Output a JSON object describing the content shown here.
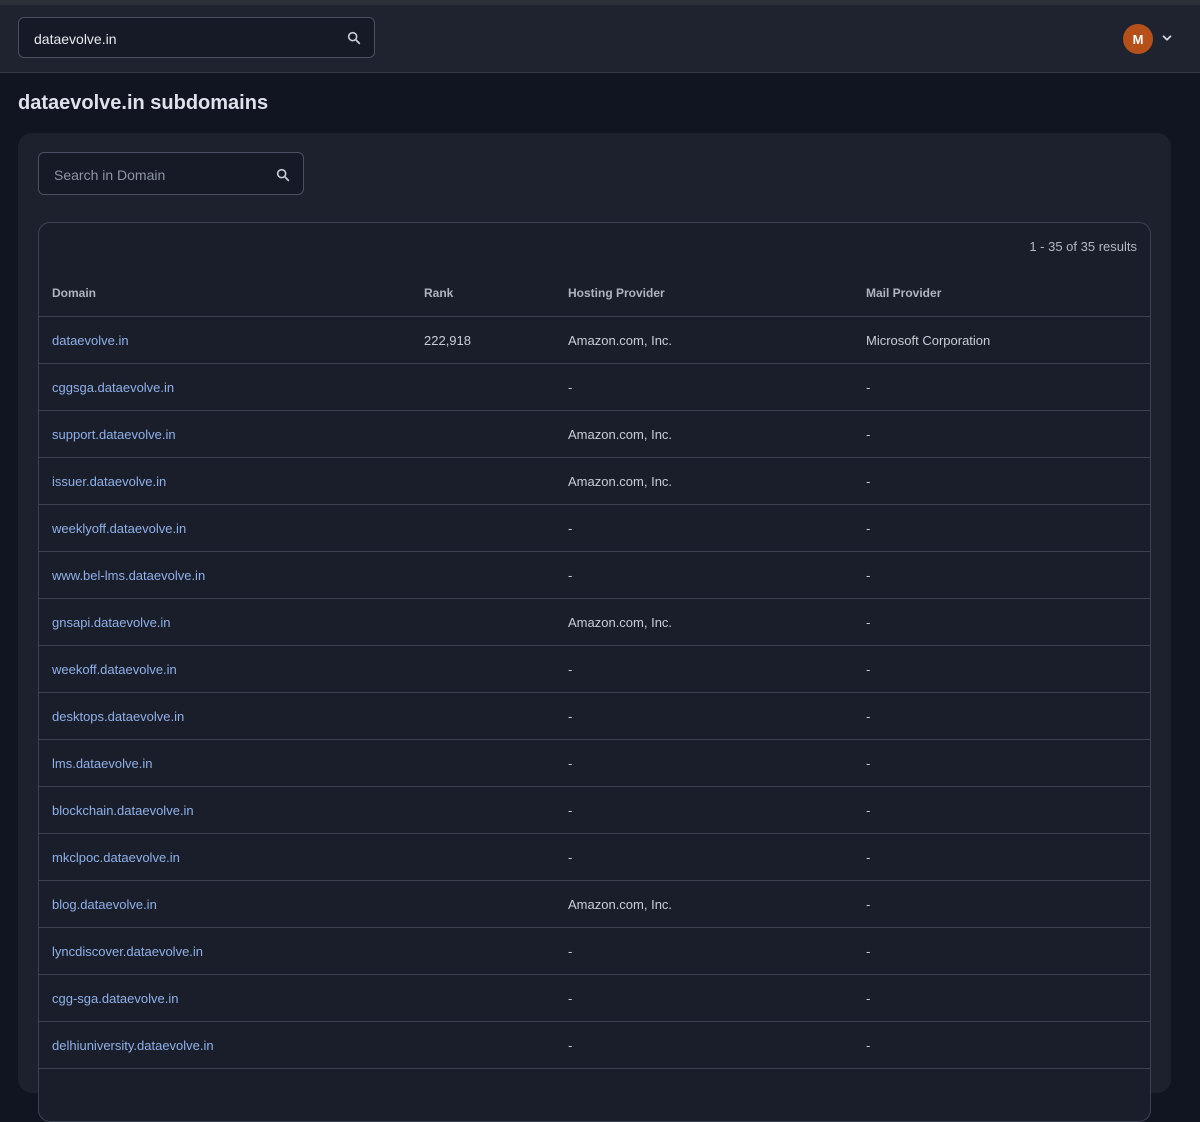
{
  "header": {
    "search_value": "dataevolve.in",
    "avatar_initial": "M",
    "search_icon": "search-icon",
    "menu_icon": "chevron-down-icon",
    "avatar_color": "#b6501b"
  },
  "page": {
    "title": "dataevolve.in subdomains"
  },
  "domain_search": {
    "placeholder": "Search in Domain",
    "icon": "search-icon"
  },
  "table": {
    "results_text": "1 - 35 of 35 results",
    "columns": [
      "Domain",
      "Rank",
      "Hosting Provider",
      "Mail Provider"
    ],
    "rows": [
      {
        "domain": "dataevolve.in",
        "rank": "222,918",
        "hosting": "Amazon.com, Inc.",
        "mail": "Microsoft Corporation"
      },
      {
        "domain": "cggsga.dataevolve.in",
        "rank": "",
        "hosting": "-",
        "mail": "-"
      },
      {
        "domain": "support.dataevolve.in",
        "rank": "",
        "hosting": "Amazon.com, Inc.",
        "mail": "-"
      },
      {
        "domain": "issuer.dataevolve.in",
        "rank": "",
        "hosting": "Amazon.com, Inc.",
        "mail": "-"
      },
      {
        "domain": "weeklyoff.dataevolve.in",
        "rank": "",
        "hosting": "-",
        "mail": "-"
      },
      {
        "domain": "www.bel-lms.dataevolve.in",
        "rank": "",
        "hosting": "-",
        "mail": "-"
      },
      {
        "domain": "gnsapi.dataevolve.in",
        "rank": "",
        "hosting": "Amazon.com, Inc.",
        "mail": "-"
      },
      {
        "domain": "weekoff.dataevolve.in",
        "rank": "",
        "hosting": "-",
        "mail": "-"
      },
      {
        "domain": "desktops.dataevolve.in",
        "rank": "",
        "hosting": "-",
        "mail": "-"
      },
      {
        "domain": "lms.dataevolve.in",
        "rank": "",
        "hosting": "-",
        "mail": "-"
      },
      {
        "domain": "blockchain.dataevolve.in",
        "rank": "",
        "hosting": "-",
        "mail": "-"
      },
      {
        "domain": "mkclpoc.dataevolve.in",
        "rank": "",
        "hosting": "-",
        "mail": "-"
      },
      {
        "domain": "blog.dataevolve.in",
        "rank": "",
        "hosting": "Amazon.com, Inc.",
        "mail": "-"
      },
      {
        "domain": "lyncdiscover.dataevolve.in",
        "rank": "",
        "hosting": "-",
        "mail": "-"
      },
      {
        "domain": "cgg-sga.dataevolve.in",
        "rank": "",
        "hosting": "-",
        "mail": "-"
      },
      {
        "domain": "delhiuniversity.dataevolve.in",
        "rank": "",
        "hosting": "-",
        "mail": "-"
      }
    ]
  }
}
